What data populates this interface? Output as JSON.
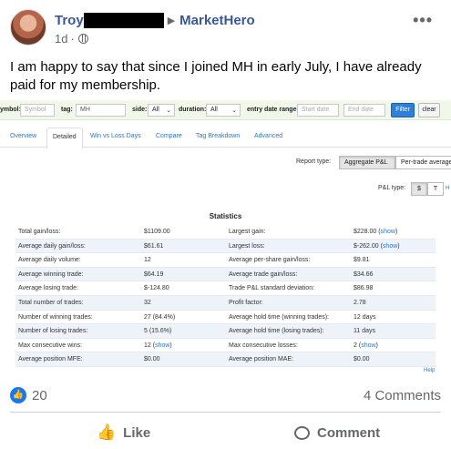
{
  "post": {
    "author": "Troy",
    "group": "MarketHero",
    "time": "1d",
    "more_icon": "ellipsis-icon",
    "text": "I am happy to say that since I joined MH in early July, I have already paid for my membership."
  },
  "filters": {
    "symbol_label": "ymbol:",
    "symbol_placeholder": "Symbol",
    "tag_label": "tag:",
    "tag_value": "MH",
    "side_label": "side:",
    "side_value": "All",
    "duration_label": "duration:",
    "duration_value": "All",
    "entry_date_label": "entry date range:",
    "start_placeholder": "Start date",
    "end_placeholder": "End date",
    "filter_button": "Filter",
    "clear_button": "clear"
  },
  "tabs": [
    "Overview",
    "Detailed",
    "Win vs Loss Days",
    "Compare",
    "Tag Breakdown",
    "Advanced"
  ],
  "report": {
    "report_type_label": "Report type:",
    "aggregate_button": "Aggregate P&L",
    "pertrade_button": "Per-trade average",
    "pl_type_label": "P&L type:",
    "dollar_button": "$",
    "t_button": "T",
    "h_link": "H"
  },
  "statistics": {
    "title": "Statistics",
    "show_link": "show",
    "rows": [
      {
        "l1": "Total gain/loss:",
        "v1": "$1109.00",
        "l2": "Largest gain:",
        "v2": "$228.00",
        "v2_link": true
      },
      {
        "l1": "Average daily gain/loss:",
        "v1": "$61.61",
        "l2": "Largest loss:",
        "v2": "$-262.00",
        "v2_link": true
      },
      {
        "l1": "Average daily volume:",
        "v1": "12",
        "l2": "Average per-share gain/loss:",
        "v2": "$9.81"
      },
      {
        "l1": "Average winning trade:",
        "v1": "$64.19",
        "l2": "Average trade gain/loss:",
        "v2": "$34.66"
      },
      {
        "l1": "Average losing trade:",
        "v1": "$-124.80",
        "l2": "Trade P&L standard deviation:",
        "v2": "$86.98"
      },
      {
        "l1": "Total number of trades:",
        "v1": "32",
        "l2": "Profit factor:",
        "v2": "2.78"
      },
      {
        "l1": "Number of winning trades:",
        "v1": "27 (84.4%)",
        "l2": "Average hold time (winning trades):",
        "v2": "12 days"
      },
      {
        "l1": "Number of losing trades:",
        "v1": "5 (15.6%)",
        "l2": "Average hold time (losing trades):",
        "v2": "11 days"
      },
      {
        "l1": "Max consecutive wins:",
        "v1": "12",
        "v1_link": true,
        "l2": "Max consecutive losses:",
        "v2": "2",
        "v2_link": true
      },
      {
        "l1": "Average position MFE:",
        "v1": "$0.00",
        "l2": "Average position MAE:",
        "v2": "$0.00"
      }
    ],
    "help_link": "Help"
  },
  "engagement": {
    "reaction_count": "20",
    "comments": "4 Comments",
    "like_label": "Like",
    "comment_label": "Comment"
  },
  "colors": {
    "link": "#385898",
    "accent": "#1877f2",
    "muted": "#65676b"
  }
}
